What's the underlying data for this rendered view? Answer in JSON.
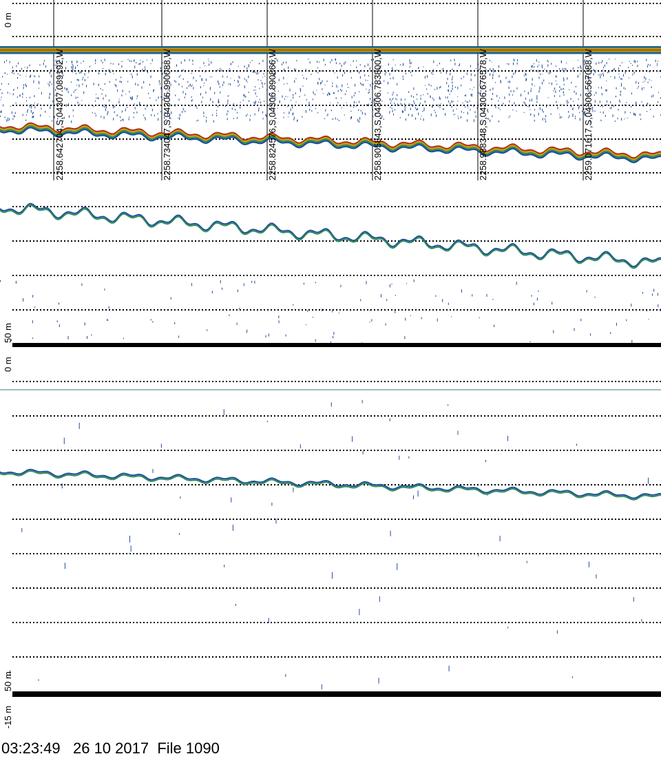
{
  "depth_labels": {
    "panel1_top": "0 m",
    "panel1_bottom": "50 m",
    "panel2_top": "0 m",
    "panel2_bottom": "50 m",
    "panel2_lower": "-15 m"
  },
  "position_marks": [
    "2258.642704,S,04307.089192,W",
    "2258.734047,S,04306.990088,W",
    "2258.824576,S,04306.890866,W",
    "2258.905843,S,04306.783800,W",
    "2258.988348,S,04306.676578,W",
    "2259.071617,S,04306.567088,W"
  ],
  "footer": {
    "time": "03:23:49",
    "date": "26 10 2017",
    "file": "File 1090"
  },
  "colors": {
    "grid": "#000000",
    "echo_low": "#1f4e9c",
    "echo_mid": "#2e8b57",
    "echo_high": "#c8a000",
    "echo_max": "#b03020",
    "bottom_bar": "#000000"
  }
}
